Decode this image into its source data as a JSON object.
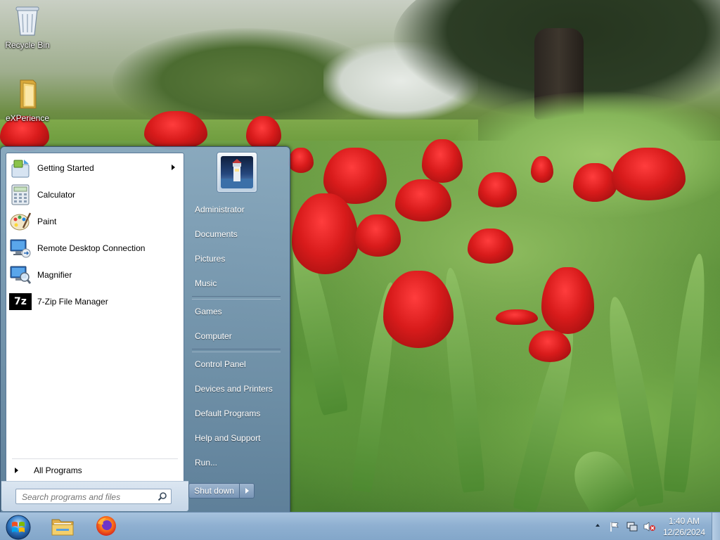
{
  "desktop": {
    "icons": [
      {
        "label": "Recycle Bin",
        "icon": "recycle-bin-icon"
      },
      {
        "label": "eXPerience",
        "icon": "folder-icon"
      }
    ]
  },
  "start_menu": {
    "programs": [
      {
        "label": "Getting Started",
        "icon": "getting-started-icon",
        "has_submenu": true
      },
      {
        "label": "Calculator",
        "icon": "calculator-icon"
      },
      {
        "label": "Paint",
        "icon": "paint-icon"
      },
      {
        "label": "Remote Desktop Connection",
        "icon": "remote-desktop-icon"
      },
      {
        "label": "Magnifier",
        "icon": "magnifier-icon"
      },
      {
        "label": "7-Zip File Manager",
        "icon": "7zip-icon",
        "icon_text": "7z"
      }
    ],
    "all_programs": "All Programs",
    "search": {
      "placeholder": "Search programs and files"
    },
    "right_items": {
      "administrator": "Administrator",
      "documents": "Documents",
      "pictures": "Pictures",
      "music": "Music",
      "games": "Games",
      "computer": "Computer",
      "control_panel": "Control Panel",
      "devices_printers": "Devices and Printers",
      "default_programs": "Default Programs",
      "help_support": "Help and Support",
      "run": "Run..."
    },
    "shutdown": "Shut down"
  },
  "taskbar": {
    "pinned": [
      {
        "name": "windows-explorer",
        "icon": "folder-icon"
      },
      {
        "name": "firefox",
        "icon": "firefox-icon"
      }
    ],
    "clock": {
      "time": "1:40 AM",
      "date": "12/26/2024"
    }
  },
  "colors": {
    "taskbar": "#8fb0d1",
    "start_menu_right": "#7f9cbb"
  }
}
